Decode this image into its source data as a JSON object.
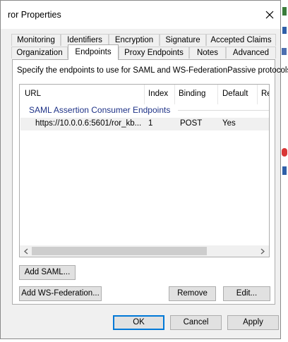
{
  "window": {
    "title": "ror Properties"
  },
  "tabs_back": [
    "Monitoring",
    "Identifiers",
    "Encryption",
    "Signature",
    "Accepted Claims"
  ],
  "tabs_front": [
    "Organization",
    "Endpoints",
    "Proxy Endpoints",
    "Notes",
    "Advanced"
  ],
  "panel": {
    "description": "Specify the endpoints to use for SAML and WS-FederationPassive protocols."
  },
  "list": {
    "columns": [
      "URL",
      "Index",
      "Binding",
      "Default",
      "Re"
    ],
    "group": "SAML Assertion Consumer Endpoints",
    "rows": [
      {
        "url": "https://10.0.0.6:5601/ror_kb...",
        "index": "1",
        "binding": "POST",
        "default": "Yes"
      }
    ]
  },
  "buttons": {
    "add_saml": "Add SAML...",
    "add_ws_federation": "Add WS-Federation...",
    "remove": "Remove",
    "edit": "Edit...",
    "ok": "OK",
    "cancel": "Cancel",
    "apply": "Apply"
  },
  "colors": {
    "accent": "#0078d7",
    "group_label": "#1e3287"
  }
}
